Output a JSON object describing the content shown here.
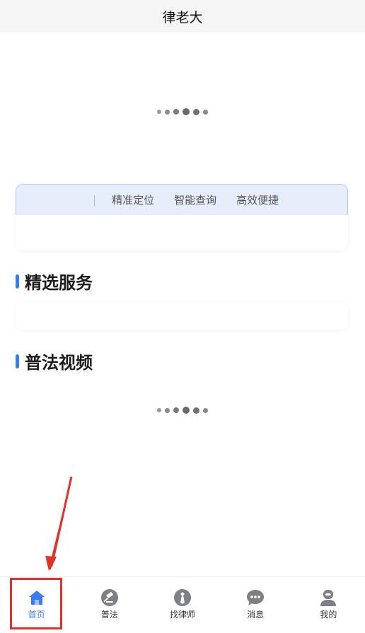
{
  "header": {
    "title": "律老大"
  },
  "features": {
    "tags": [
      "精准定位",
      "智能查询",
      "高效便捷"
    ]
  },
  "sections": {
    "services_title": "精选服务",
    "videos_title": "普法视频"
  },
  "tabbar": {
    "items": [
      {
        "label": "首页",
        "icon": "home-icon",
        "active": true
      },
      {
        "label": "普法",
        "icon": "gavel-icon",
        "active": false
      },
      {
        "label": "找律师",
        "icon": "lawyer-icon",
        "active": false
      },
      {
        "label": "消息",
        "icon": "chat-icon",
        "active": false
      },
      {
        "label": "我的",
        "icon": "profile-icon",
        "active": false
      }
    ]
  },
  "colors": {
    "accent": "#3a7bf2",
    "annotation": "#e0312b"
  }
}
